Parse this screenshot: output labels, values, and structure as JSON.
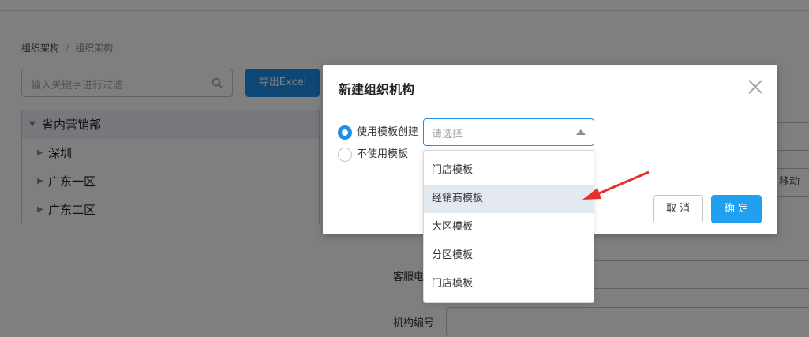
{
  "breadcrumb": {
    "first": "组织架构",
    "separator": "/",
    "current": "组织架构"
  },
  "filter": {
    "placeholder": "输入关键字进行过滤"
  },
  "export_button": "导出Excel",
  "tree": {
    "root": "省内营销部",
    "children": [
      "深圳",
      "广东一区",
      "广东二区"
    ]
  },
  "background_form": {
    "service_phone_label": "客服电",
    "org_code_label": "机构编号",
    "move_button": "移动"
  },
  "modal": {
    "title": "新建组织机构",
    "option_use_template": "使用模板创建",
    "option_no_template": "不使用模板",
    "select_placeholder": "请选择",
    "cancel": "取消",
    "confirm": "确定"
  },
  "dropdown": {
    "options": [
      "门店模板",
      "经销商模板",
      "大区模板",
      "分区模板",
      "门店模板"
    ],
    "hovered_index": 1
  },
  "colors": {
    "primary": "#1e8fe8",
    "annotation_arrow": "#e8302a"
  }
}
